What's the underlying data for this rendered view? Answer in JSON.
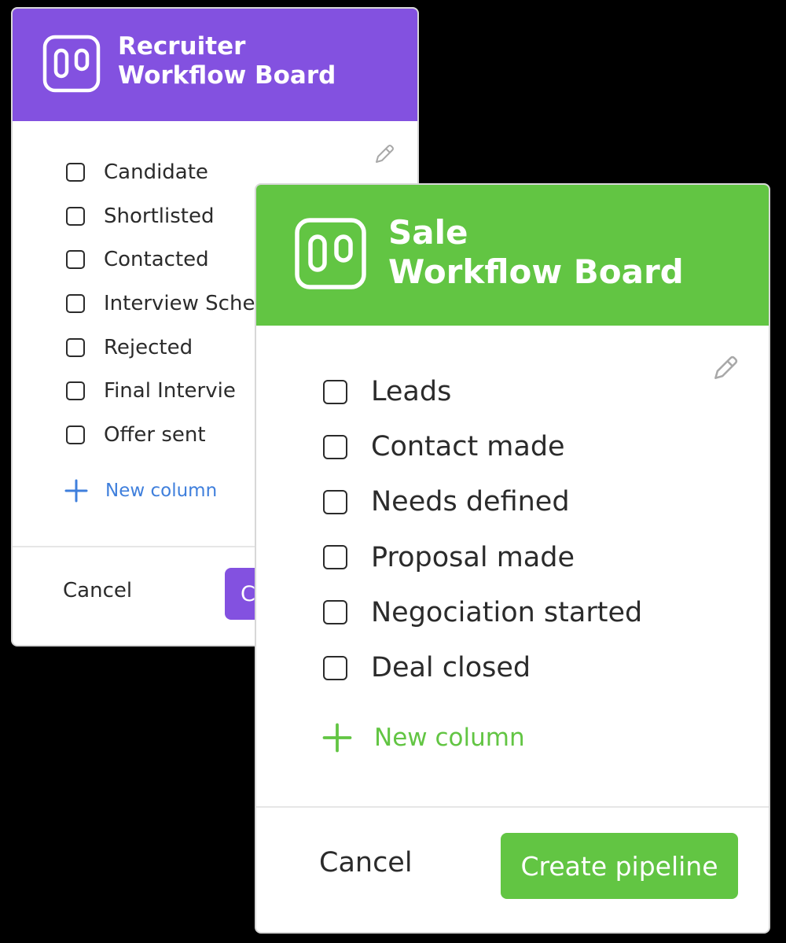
{
  "recruiter_board": {
    "title_line1": "Recruiter",
    "title_line2": "Workflow Board",
    "header_color": "#8351e0",
    "logo_icon": "kanban-board-icon",
    "edit_icon": "pencil-icon",
    "columns": [
      {
        "label": "Candidate"
      },
      {
        "label": "Shortlisted"
      },
      {
        "label": "Contacted"
      },
      {
        "label": "Interview Sche"
      },
      {
        "label": "Rejected"
      },
      {
        "label": "Final Intervie"
      },
      {
        "label": "Offer sent"
      }
    ],
    "new_column_label": "New column",
    "new_column_color": "#3f7fdc",
    "cancel_label": "Cancel",
    "primary_label": "C"
  },
  "sale_board": {
    "title_line1": "Sale",
    "title_line2": "Workflow Board",
    "header_color": "#62c543",
    "logo_icon": "kanban-board-icon",
    "edit_icon": "pencil-icon",
    "columns": [
      {
        "label": "Leads"
      },
      {
        "label": "Contact made"
      },
      {
        "label": "Needs defined"
      },
      {
        "label": "Proposal made"
      },
      {
        "label": "Negociation started"
      },
      {
        "label": "Deal closed"
      }
    ],
    "new_column_label": "New column",
    "new_column_color": "#62c543",
    "cancel_label": "Cancel",
    "primary_label": "Create pipeline"
  }
}
